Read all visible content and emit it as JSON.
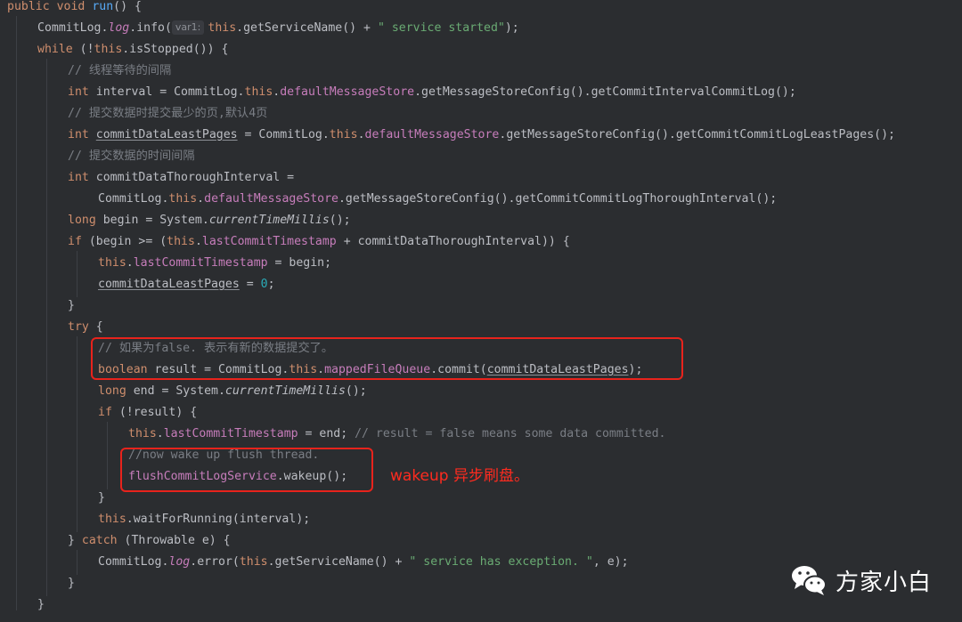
{
  "code": {
    "l1": {
      "kw1": "public",
      "kw2": "void",
      "name": "run",
      "rest": "() {"
    },
    "l2": {
      "cls": "CommitLog.",
      "fld": "log",
      "dot": ".",
      "fn": "info(",
      "hint": "var1:",
      "this": "this",
      "call": ".getServiceName() + ",
      "str": "\" service started\"",
      "end": ");"
    },
    "l3": {
      "kw": "while",
      "a": " (!",
      "this": "this",
      "b": ".isStopped()) {"
    },
    "l4": {
      "cmt": "// 线程等待的间隔"
    },
    "l5": {
      "kw": "int",
      "a": " interval = CommitLog.",
      "this": "this",
      "dot": ".",
      "fld": "defaultMessageStore",
      "b": ".getMessageStoreConfig().getCommitIntervalCommitLog();"
    },
    "l6": {
      "cmt": "// 提交数据时提交最少的页,默认4页"
    },
    "l7": {
      "kw": "int",
      "sp": " ",
      "var": "commitDataLeastPages",
      "a": " = CommitLog.",
      "this": "this",
      "dot": ".",
      "fld": "defaultMessageStore",
      "b": ".getMessageStoreConfig().getCommitCommitLogLeastPages();"
    },
    "l8": {
      "cmt": "// 提交数据的时间间隔"
    },
    "l9": {
      "kw": "int",
      "a": " commitDataThoroughInterval ="
    },
    "l10": {
      "a": "CommitLog.",
      "this": "this",
      "dot": ".",
      "fld": "defaultMessageStore",
      "b": ".getMessageStoreConfig().getCommitCommitLogThoroughInterval();"
    },
    "l11": {
      "kw": "long",
      "a": " begin = System.",
      "it": "currentTimeMillis",
      "b": "();"
    },
    "l12": {
      "kw": "if",
      "a": " (begin >= (",
      "this": "this",
      "dot": ".",
      "fld": "lastCommitTimestamp",
      "b": " + commitDataThoroughInterval)) {"
    },
    "l13": {
      "this": "this",
      "dot": ".",
      "fld": "lastCommitTimestamp",
      "b": " = begin;"
    },
    "l14": {
      "var": "commitDataLeastPages",
      "a": " = ",
      "num": "0",
      "b": ";"
    },
    "l15": {
      "a": "}"
    },
    "l16": {
      "kw": "try",
      "a": " {"
    },
    "l17": {
      "cmt": "// 如果为false. 表示有新的数据提交了。"
    },
    "l18": {
      "kw": "boolean",
      "a": " result = CommitLog.",
      "this": "this",
      "dot": ".",
      "fld": "mappedFileQueue",
      "b": ".commit(",
      "var": "commitDataLeastPages",
      "c": ");"
    },
    "l19": {
      "kw": "long",
      "a": " end = System.",
      "it": "currentTimeMillis",
      "b": "();"
    },
    "l20": {
      "kw": "if",
      "a": " (!result) {"
    },
    "l21": {
      "this": "this",
      "dot": ".",
      "fld": "lastCommitTimestamp",
      "b": " = end; ",
      "cmt": "// result = false means some data committed."
    },
    "l22": {
      "cmt": "//now wake up flush thread."
    },
    "l23": {
      "fld": "flushCommitLogService",
      "b": ".wakeup();"
    },
    "l24": {
      "a": "}"
    },
    "l25": {
      "this": "this",
      "b": ".waitForRunning(interval);"
    },
    "l26": {
      "a": "} ",
      "kw": "catch",
      "b": " (Throwable e) {"
    },
    "l27": {
      "a": "CommitLog.",
      "fld": "log",
      "dot": ".",
      "b": "error(",
      "this": "this",
      "c": ".getServiceName() + ",
      "str": "\" service has exception. \"",
      "d": ", e);"
    },
    "l28": {
      "a": "}"
    },
    "l29": {
      "a": "}"
    }
  },
  "annotation": "wakeup 异步刷盘。",
  "watermark": {
    "text": "方家小白",
    "icon": "wechat-icon"
  },
  "colors": {
    "highlight_box": "#e8231c",
    "annotation": "#ff2b1f",
    "background": "#2b2d30"
  }
}
